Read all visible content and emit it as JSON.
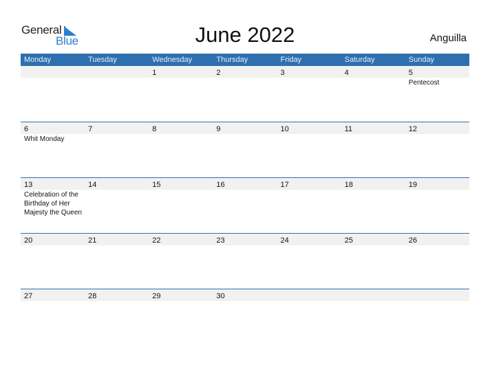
{
  "logo": {
    "word1": "General",
    "word2": "Blue",
    "icon": "triangle-flag-icon"
  },
  "title": "June 2022",
  "country": "Anguilla",
  "colors": {
    "header": "#2e6fb0",
    "accent": "#2a7fd0",
    "strip": "#f1f1f1"
  },
  "weekdays": [
    "Monday",
    "Tuesday",
    "Wednesday",
    "Thursday",
    "Friday",
    "Saturday",
    "Sunday"
  ],
  "weeks": [
    {
      "days": [
        "",
        "",
        "1",
        "2",
        "3",
        "4",
        "5"
      ],
      "events": [
        "",
        "",
        "",
        "",
        "",
        "",
        "Pentecost"
      ]
    },
    {
      "days": [
        "6",
        "7",
        "8",
        "9",
        "10",
        "11",
        "12"
      ],
      "events": [
        "Whit Monday",
        "",
        "",
        "",
        "",
        "",
        ""
      ]
    },
    {
      "days": [
        "13",
        "14",
        "15",
        "16",
        "17",
        "18",
        "19"
      ],
      "events": [
        "Celebration of the Birthday of Her Majesty the Queen",
        "",
        "",
        "",
        "",
        "",
        ""
      ]
    },
    {
      "days": [
        "20",
        "21",
        "22",
        "23",
        "24",
        "25",
        "26"
      ],
      "events": [
        "",
        "",
        "",
        "",
        "",
        "",
        ""
      ]
    },
    {
      "days": [
        "27",
        "28",
        "29",
        "30",
        "",
        "",
        ""
      ],
      "events": [
        "",
        "",
        "",
        "",
        "",
        "",
        ""
      ]
    }
  ]
}
